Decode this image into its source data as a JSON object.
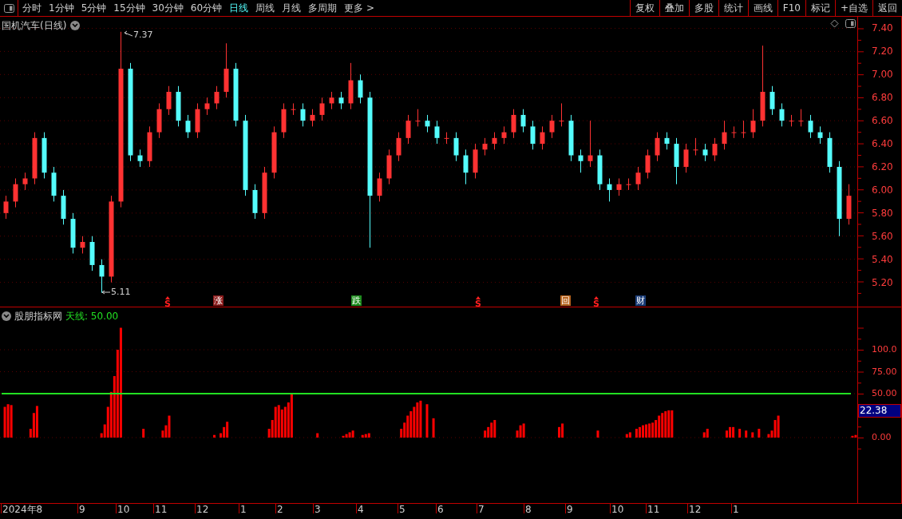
{
  "toolbar": {
    "periods": [
      {
        "label": "分时",
        "selected": false
      },
      {
        "label": "1分钟",
        "selected": false
      },
      {
        "label": "5分钟",
        "selected": false
      },
      {
        "label": "15分钟",
        "selected": false
      },
      {
        "label": "30分钟",
        "selected": false
      },
      {
        "label": "60分钟",
        "selected": false
      },
      {
        "label": "日线",
        "selected": true
      },
      {
        "label": "周线",
        "selected": false
      },
      {
        "label": "月线",
        "selected": false
      },
      {
        "label": "多周期",
        "selected": false
      },
      {
        "label": "更多 >",
        "selected": false
      }
    ],
    "buttons": [
      "复权",
      "叠加",
      "多股",
      "统计",
      "画线",
      "F10",
      "标记",
      "+自选",
      "返回"
    ]
  },
  "price_panel": {
    "title": "国机汽车(日线)",
    "high_label": "7.37",
    "low_label": "5.11",
    "chart_data": {
      "type": "candlestick",
      "ylim": [
        4.99,
        7.5
      ],
      "grid": true,
      "yticks": [
        {
          "value": 7.4,
          "label": "7.40"
        },
        {
          "value": 7.2,
          "label": "7.20"
        },
        {
          "value": 7.0,
          "label": "7.00"
        },
        {
          "value": 6.8,
          "label": "6.80"
        },
        {
          "value": 6.6,
          "label": "6.60"
        },
        {
          "value": 6.4,
          "label": "6.40"
        },
        {
          "value": 6.2,
          "label": "6.20"
        },
        {
          "value": 6.0,
          "label": "6.00"
        },
        {
          "value": 5.8,
          "label": "5.80"
        },
        {
          "value": 5.6,
          "label": "5.60"
        },
        {
          "value": 5.4,
          "label": "5.40"
        },
        {
          "value": 5.2,
          "label": "5.20"
        }
      ],
      "ohlc": [
        [
          5.8,
          5.95,
          5.75,
          5.9
        ],
        [
          5.9,
          6.1,
          5.85,
          6.05
        ],
        [
          6.05,
          6.15,
          6.0,
          6.1
        ],
        [
          6.1,
          6.5,
          6.05,
          6.45
        ],
        [
          6.45,
          6.5,
          6.1,
          6.15
        ],
        [
          6.15,
          6.2,
          5.9,
          5.95
        ],
        [
          5.95,
          6.0,
          5.7,
          5.75
        ],
        [
          5.75,
          5.8,
          5.45,
          5.5
        ],
        [
          5.5,
          5.6,
          5.45,
          5.55
        ],
        [
          5.55,
          5.6,
          5.3,
          5.35
        ],
        [
          5.35,
          5.4,
          5.11,
          5.25
        ],
        [
          5.25,
          5.95,
          5.2,
          5.9
        ],
        [
          5.9,
          7.37,
          5.85,
          7.05
        ],
        [
          7.05,
          7.1,
          6.25,
          6.3
        ],
        [
          6.3,
          6.35,
          6.2,
          6.25
        ],
        [
          6.25,
          6.55,
          6.2,
          6.5
        ],
        [
          6.5,
          6.75,
          6.45,
          6.7
        ],
        [
          6.7,
          6.9,
          6.65,
          6.85
        ],
        [
          6.85,
          6.9,
          6.55,
          6.6
        ],
        [
          6.6,
          6.65,
          6.45,
          6.5
        ],
        [
          6.5,
          6.75,
          6.45,
          6.7
        ],
        [
          6.7,
          6.8,
          6.65,
          6.75
        ],
        [
          6.75,
          6.9,
          6.7,
          6.85
        ],
        [
          6.85,
          7.27,
          6.8,
          7.05
        ],
        [
          7.05,
          7.1,
          6.55,
          6.6
        ],
        [
          6.6,
          6.65,
          5.95,
          6.0
        ],
        [
          6.0,
          6.05,
          5.75,
          5.8
        ],
        [
          5.8,
          6.2,
          5.75,
          6.15
        ],
        [
          6.15,
          6.55,
          6.1,
          6.5
        ],
        [
          6.5,
          6.75,
          6.45,
          6.7
        ],
        [
          6.7,
          6.75,
          6.65,
          6.7
        ],
        [
          6.7,
          6.75,
          6.55,
          6.6
        ],
        [
          6.6,
          6.7,
          6.55,
          6.65
        ],
        [
          6.65,
          6.8,
          6.6,
          6.75
        ],
        [
          6.75,
          6.85,
          6.7,
          6.8
        ],
        [
          6.8,
          6.85,
          6.7,
          6.75
        ],
        [
          6.75,
          7.1,
          6.7,
          6.95
        ],
        [
          6.95,
          7.0,
          6.75,
          6.8
        ],
        [
          6.8,
          6.85,
          5.5,
          5.95
        ],
        [
          5.95,
          6.15,
          5.9,
          6.1
        ],
        [
          6.1,
          6.35,
          6.05,
          6.3
        ],
        [
          6.3,
          6.5,
          6.25,
          6.45
        ],
        [
          6.45,
          6.65,
          6.4,
          6.6
        ],
        [
          6.6,
          6.7,
          6.55,
          6.6
        ],
        [
          6.6,
          6.65,
          6.5,
          6.55
        ],
        [
          6.55,
          6.6,
          6.4,
          6.45
        ],
        [
          6.45,
          6.5,
          6.4,
          6.45
        ],
        [
          6.45,
          6.5,
          6.25,
          6.3
        ],
        [
          6.3,
          6.35,
          6.05,
          6.15
        ],
        [
          6.15,
          6.4,
          6.1,
          6.35
        ],
        [
          6.35,
          6.45,
          6.3,
          6.4
        ],
        [
          6.4,
          6.5,
          6.35,
          6.45
        ],
        [
          6.45,
          6.55,
          6.4,
          6.5
        ],
        [
          6.5,
          6.7,
          6.45,
          6.65
        ],
        [
          6.65,
          6.7,
          6.5,
          6.55
        ],
        [
          6.55,
          6.6,
          6.35,
          6.4
        ],
        [
          6.4,
          6.55,
          6.35,
          6.5
        ],
        [
          6.5,
          6.65,
          6.45,
          6.6
        ],
        [
          6.6,
          6.75,
          6.55,
          6.6
        ],
        [
          6.6,
          6.65,
          6.25,
          6.3
        ],
        [
          6.3,
          6.35,
          6.15,
          6.25
        ],
        [
          6.25,
          6.6,
          6.2,
          6.3
        ],
        [
          6.3,
          6.35,
          6.0,
          6.05
        ],
        [
          6.05,
          6.1,
          5.9,
          6.0
        ],
        [
          6.0,
          6.1,
          5.95,
          6.05
        ],
        [
          6.05,
          6.1,
          6.0,
          6.05
        ],
        [
          6.05,
          6.2,
          6.0,
          6.15
        ],
        [
          6.15,
          6.35,
          6.1,
          6.3
        ],
        [
          6.3,
          6.5,
          6.25,
          6.45
        ],
        [
          6.45,
          6.5,
          6.35,
          6.4
        ],
        [
          6.4,
          6.45,
          6.05,
          6.2
        ],
        [
          6.2,
          6.4,
          6.15,
          6.35
        ],
        [
          6.35,
          6.45,
          6.3,
          6.35
        ],
        [
          6.35,
          6.4,
          6.25,
          6.3
        ],
        [
          6.3,
          6.45,
          6.25,
          6.4
        ],
        [
          6.4,
          6.6,
          6.35,
          6.5
        ],
        [
          6.5,
          6.55,
          6.45,
          6.5
        ],
        [
          6.5,
          6.6,
          6.45,
          6.5
        ],
        [
          6.5,
          6.7,
          6.45,
          6.6
        ],
        [
          6.6,
          7.25,
          6.55,
          6.85
        ],
        [
          6.85,
          6.9,
          6.65,
          6.7
        ],
        [
          6.7,
          6.75,
          6.55,
          6.6
        ],
        [
          6.6,
          6.65,
          6.55,
          6.6
        ],
        [
          6.6,
          6.7,
          6.55,
          6.6
        ],
        [
          6.6,
          6.65,
          6.45,
          6.5
        ],
        [
          6.5,
          6.55,
          6.4,
          6.45
        ],
        [
          6.45,
          6.5,
          6.15,
          6.2
        ],
        [
          6.2,
          6.25,
          5.6,
          5.75
        ],
        [
          5.75,
          6.05,
          5.7,
          5.95
        ]
      ]
    },
    "markers": [
      {
        "kind": "signal",
        "text": "S",
        "color": "#ff2020"
      },
      {
        "kind": "badge",
        "text": "涨",
        "color": "#8b1a1a"
      },
      {
        "kind": "badge",
        "text": "跌",
        "color": "#1e8c1e"
      },
      {
        "kind": "signal",
        "text": "S",
        "color": "#ff2020"
      },
      {
        "kind": "badge",
        "text": "回",
        "color": "#b8641e"
      },
      {
        "kind": "signal",
        "text": "S",
        "color": "#ff2020"
      },
      {
        "kind": "badge",
        "text": "财",
        "color": "#1a3c78"
      }
    ]
  },
  "indicator_panel": {
    "title": "股朋指标网",
    "line_label": "天线: 50.00",
    "current_value": "22.38",
    "chart_data": {
      "type": "bar",
      "ylim": [
        -74.5,
        148.2
      ],
      "grid": true,
      "categories": [
        null,
        null,
        null,
        null,
        null,
        null,
        null,
        null,
        null,
        null,
        null,
        null,
        null,
        null,
        null,
        null,
        null,
        null,
        null,
        null,
        null,
        null,
        null,
        null,
        null,
        null,
        null,
        null,
        null,
        null,
        null,
        null,
        null,
        null,
        null,
        null,
        null,
        null,
        null,
        null,
        null,
        null,
        null,
        null,
        null,
        null,
        null,
        null,
        null,
        null,
        null,
        null,
        null,
        null,
        null,
        null,
        null,
        null,
        null,
        null,
        null,
        null,
        null,
        null,
        null,
        null,
        null,
        null,
        null,
        null,
        null,
        null,
        null,
        null,
        null,
        null,
        null,
        null,
        null,
        null,
        null,
        null,
        null,
        null,
        null,
        null,
        null,
        null,
        null,
        null,
        null,
        null,
        null,
        null,
        null,
        null,
        null,
        null,
        null,
        null,
        null,
        null,
        null,
        null,
        null,
        null,
        null,
        null,
        null,
        null,
        null,
        null,
        null,
        null,
        null,
        null,
        null,
        null,
        null,
        null,
        null,
        null,
        null,
        null,
        null,
        null,
        null,
        null,
        null,
        null,
        null,
        null,
        null,
        null,
        null,
        null,
        null,
        null,
        null,
        null,
        null,
        null,
        null,
        null,
        null,
        null,
        null,
        null,
        null,
        null,
        null,
        null,
        null,
        null,
        null,
        null,
        null,
        null,
        null,
        null,
        null,
        null,
        null,
        null,
        null,
        null,
        null,
        null,
        null,
        null,
        null,
        null,
        null,
        null,
        null,
        null,
        null,
        null,
        null,
        null,
        null,
        null,
        null,
        null,
        null,
        null,
        null,
        null,
        null,
        null,
        null,
        null,
        null,
        null,
        null,
        null,
        null,
        null,
        null,
        null,
        null,
        null,
        null,
        null,
        null,
        null,
        null,
        null,
        null,
        null,
        null,
        null,
        null,
        null,
        null,
        null,
        null,
        null,
        null,
        null,
        null,
        null,
        null,
        null,
        null,
        null,
        null,
        null,
        null,
        null,
        null,
        null,
        null,
        null,
        null,
        null,
        null,
        null,
        null,
        null,
        null,
        null,
        null,
        null,
        null,
        null,
        null,
        null,
        null,
        null,
        null,
        null,
        null,
        null,
        null,
        null,
        null,
        null,
        null,
        null,
        null,
        null,
        null,
        null,
        null,
        null
      ],
      "yticks": [
        {
          "value": 0,
          "label": "0.00"
        },
        {
          "value": 50,
          "label": "50.00"
        },
        {
          "value": 75,
          "label": "75.00"
        },
        {
          "value": 100,
          "label": "100.0"
        }
      ],
      "ref_lines": [
        {
          "axis": "y",
          "value": 50
        }
      ],
      "series": [
        {
          "color": "#ff0000",
          "values": [
            0,
            35,
            38,
            37,
            0,
            0,
            0,
            0,
            0,
            10,
            28,
            36,
            0,
            0,
            0,
            0,
            0,
            0,
            0,
            0,
            0,
            0,
            0,
            0,
            0,
            0,
            0,
            0,
            0,
            0,
            0,
            5,
            15,
            35,
            52,
            70,
            100,
            125,
            0,
            0,
            0,
            0,
            0,
            0,
            10,
            0,
            0,
            0,
            0,
            0,
            8,
            14,
            25,
            0,
            0,
            0,
            0,
            0,
            0,
            0,
            0,
            0,
            0,
            0,
            0,
            0,
            3,
            0,
            5,
            12,
            18,
            0,
            0,
            0,
            0,
            0,
            0,
            0,
            0,
            0,
            0,
            0,
            0,
            10,
            20,
            35,
            37,
            32,
            35,
            40,
            50,
            0,
            0,
            0,
            0,
            0,
            0,
            0,
            5,
            0,
            0,
            0,
            0,
            0,
            0,
            0,
            2,
            4,
            6,
            8,
            0,
            0,
            3,
            4,
            5,
            0,
            0,
            0,
            0,
            0,
            0,
            0,
            0,
            0,
            10,
            17,
            25,
            30,
            35,
            40,
            42,
            0,
            38,
            0,
            22,
            0,
            0,
            0,
            0,
            0,
            0,
            0,
            0,
            0,
            0,
            0,
            0,
            0,
            0,
            0,
            8,
            12,
            17,
            20,
            0,
            0,
            0,
            0,
            0,
            0,
            8,
            14,
            16,
            0,
            0,
            0,
            0,
            0,
            0,
            0,
            0,
            0,
            0,
            12,
            16,
            0,
            0,
            0,
            0,
            0,
            0,
            0,
            0,
            0,
            0,
            8,
            0,
            0,
            0,
            0,
            0,
            0,
            0,
            0,
            4,
            6,
            0,
            10,
            12,
            14,
            15,
            16,
            17,
            20,
            25,
            28,
            30,
            31,
            31,
            0,
            0,
            0,
            0,
            0,
            0,
            0,
            0,
            0,
            6,
            10,
            0,
            0,
            0,
            0,
            0,
            8,
            12,
            12,
            0,
            10,
            0,
            8,
            0,
            6,
            0,
            10,
            0,
            0,
            4,
            8,
            20,
            25,
            0,
            0,
            0,
            0,
            0,
            0,
            0,
            0,
            0,
            0,
            0,
            0,
            0,
            0,
            0,
            0,
            0,
            0,
            0,
            0,
            0,
            0,
            2,
            3
          ]
        }
      ]
    }
  },
  "date_axis": [
    "2024年8",
    "9",
    "10",
    "11",
    "12",
    "1",
    "2",
    "3",
    "4",
    "5",
    "6",
    "7",
    "8",
    "9",
    "10",
    "11",
    "12",
    "1"
  ]
}
